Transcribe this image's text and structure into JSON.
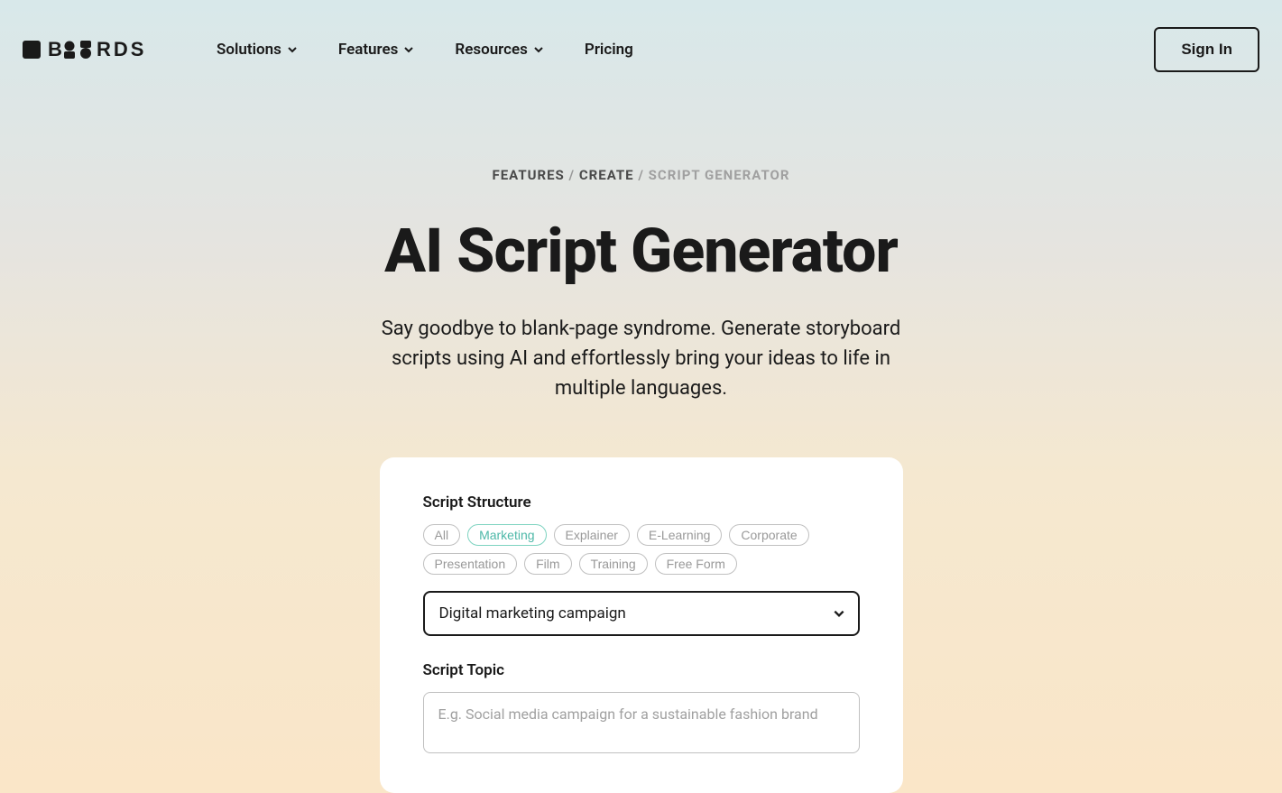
{
  "nav": {
    "items": [
      {
        "label": "Solutions",
        "hasDropdown": true
      },
      {
        "label": "Features",
        "hasDropdown": true
      },
      {
        "label": "Resources",
        "hasDropdown": true
      },
      {
        "label": "Pricing",
        "hasDropdown": false
      }
    ],
    "signIn": "Sign In"
  },
  "breadcrumb": {
    "item1": "FEATURES",
    "item2": "CREATE",
    "current": "SCRIPT GENERATOR"
  },
  "page": {
    "title": "AI Script Generator",
    "subtitle": "Say goodbye to blank-page syndrome. Generate storyboard scripts using AI and effortlessly bring your ideas to life in multiple languages."
  },
  "form": {
    "structureLabel": "Script Structure",
    "tags": [
      {
        "label": "All",
        "active": false
      },
      {
        "label": "Marketing",
        "active": true
      },
      {
        "label": "Explainer",
        "active": false
      },
      {
        "label": "E-Learning",
        "active": false
      },
      {
        "label": "Corporate",
        "active": false
      },
      {
        "label": "Presentation",
        "active": false
      },
      {
        "label": "Film",
        "active": false
      },
      {
        "label": "Training",
        "active": false
      },
      {
        "label": "Free Form",
        "active": false
      }
    ],
    "selectValue": "Digital marketing campaign",
    "topicLabel": "Script Topic",
    "topicPlaceholder": "E.g. Social media campaign for a sustainable fashion brand"
  }
}
